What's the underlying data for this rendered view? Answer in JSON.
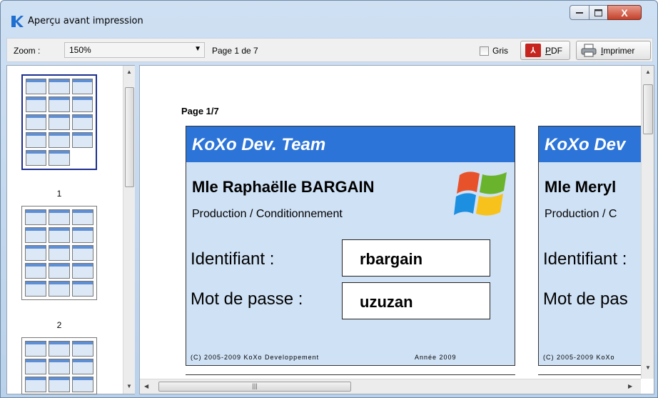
{
  "window": {
    "title": "Aperçu avant impression",
    "close_glyph": "X"
  },
  "toolbar": {
    "zoom_label": "Zoom :",
    "zoom_value": "150%",
    "page_info": "Page 1 de 7",
    "gris_label": "Gris",
    "gris_checked": false,
    "pdf_label": "PDF",
    "print_label": "Imprimer"
  },
  "thumbnails": {
    "items": [
      {
        "number": "1",
        "selected": true
      },
      {
        "number": "2",
        "selected": false
      }
    ]
  },
  "preview": {
    "page_label": "Page 1/7",
    "cards": [
      {
        "header": "KoXo Dev. Team",
        "name": "Mle Raphaëlle BARGAIN",
        "department": "Production / Conditionnement",
        "id_label": "Identifiant :",
        "id_value": "rbargain",
        "password_label": "Mot de passe :",
        "password_value": "uzuzan",
        "footer_left": "(C) 2005-2009 KoXo Developpement",
        "footer_right": "Année 2009"
      },
      {
        "header": "KoXo Dev",
        "name": "Mle Meryl",
        "department": "Production / C",
        "id_label": "Identifiant :",
        "password_label": "Mot de pas",
        "footer_left": "(C) 2005-2009 KoXo"
      }
    ]
  },
  "colors": {
    "card_header": "#2c74d8",
    "card_body": "#cfe1f5",
    "pdf_red": "#c6251f"
  }
}
